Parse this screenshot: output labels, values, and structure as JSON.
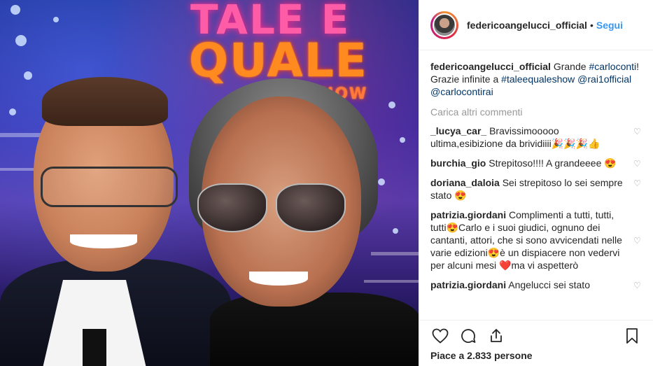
{
  "header": {
    "username": "federicoangelucci_official",
    "separator": "•",
    "follow_label": "Segui"
  },
  "caption": {
    "username": "federicoangelucci_official",
    "parts": [
      {
        "t": "text",
        "v": "Grande"
      },
      {
        "t": "tag",
        "v": "#carloconti"
      },
      {
        "t": "text",
        "v": "! Grazie infinite a"
      },
      {
        "t": "tag",
        "v": "#taleequaleshow"
      },
      {
        "t": "tag",
        "v": "@rai1official"
      },
      {
        "t": "tag",
        "v": "@carlocontirai"
      }
    ]
  },
  "load_more": "Carica altri commenti",
  "comments": [
    {
      "user": "_lucya_car_",
      "text": "Bravissimooooo ultima,esibizione da brividiiii🎉🎉🎉👍"
    },
    {
      "user": "burchia_gio",
      "text": "Strepitoso!!!! A grandeeee 😍"
    },
    {
      "user": "doriana_daloia",
      "text": "Sei strepitoso lo sei sempre stato 😍"
    },
    {
      "user": "patrizia.giordani",
      "text": "Complimenti a tutti, tutti, tutti😍Carlo e i suoi giudici, ognuno dei cantanti, attori, che si sono avvicendati nelle varie edizioni😍è un dispiacere non vedervi per alcuni mesi ❤️ma vi aspetterò"
    },
    {
      "user": "patrizia.giordani",
      "text": "Angelucci sei stato"
    }
  ],
  "likes": "Piace a 2.833 persone",
  "photo_text": {
    "tale": "TALE E",
    "quale": "QUALE",
    "show": "SHOW"
  },
  "colors": {
    "link": "#3897f0",
    "tag": "#003569",
    "muted": "#999999"
  },
  "icons": [
    "heart-icon",
    "comment-icon",
    "share-icon",
    "bookmark-icon",
    "small-heart-icon"
  ]
}
